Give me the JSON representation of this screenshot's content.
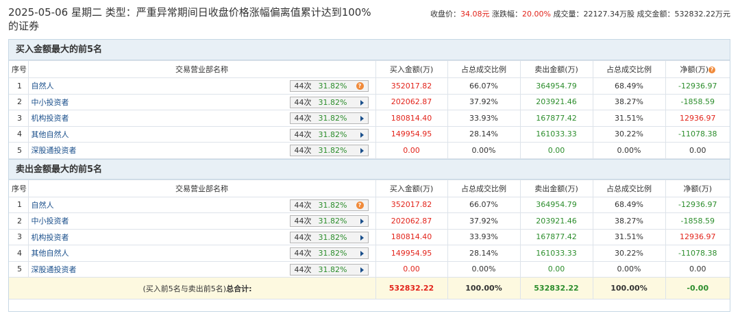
{
  "header": {
    "title": "2025-05-06 星期二 类型：严重异常期间日收盘价格涨幅偏离值累计达到100%的证券",
    "close_label": "收盘价：",
    "close_value": "34.08元",
    "change_label": "涨跌幅：",
    "change_value": "20.00%",
    "volume_label": "成交量：",
    "volume_value": "22127.34万股",
    "amount_label": "成交金额：",
    "amount_value": "532832.22万元"
  },
  "columns": [
    "序号",
    "交易营业部名称",
    "买入金额(万)",
    "占总成交比例",
    "卖出金额(万)",
    "占总成交比例",
    "净额(万)"
  ],
  "buy_section": {
    "title": "买入金额最大的前5名",
    "rows": [
      {
        "idx": "1",
        "name": "自然人",
        "times": "44次",
        "rate": "31.82%",
        "buy": "352017.82",
        "buy_pct": "66.07%",
        "sell": "364954.79",
        "sell_pct": "68.49%",
        "net": "-12936.97",
        "net_color": "green",
        "icon": "q"
      },
      {
        "idx": "2",
        "name": "中小投资者",
        "times": "44次",
        "rate": "31.82%",
        "buy": "202062.87",
        "buy_pct": "37.92%",
        "sell": "203921.46",
        "sell_pct": "38.27%",
        "net": "-1858.59",
        "net_color": "green",
        "icon": "arrow"
      },
      {
        "idx": "3",
        "name": "机构投资者",
        "times": "44次",
        "rate": "31.82%",
        "buy": "180814.40",
        "buy_pct": "33.93%",
        "sell": "167877.42",
        "sell_pct": "31.51%",
        "net": "12936.97",
        "net_color": "red",
        "icon": "arrow"
      },
      {
        "idx": "4",
        "name": "其他自然人",
        "times": "44次",
        "rate": "31.82%",
        "buy": "149954.95",
        "buy_pct": "28.14%",
        "sell": "161033.33",
        "sell_pct": "30.22%",
        "net": "-11078.38",
        "net_color": "green",
        "icon": "arrow"
      },
      {
        "idx": "5",
        "name": "深股通投资者",
        "times": "44次",
        "rate": "31.82%",
        "buy": "0.00",
        "buy_pct": "0.00%",
        "sell": "0.00",
        "sell_pct": "0.00%",
        "net": "0.00",
        "net_color": "plain",
        "icon": "arrow"
      }
    ]
  },
  "sell_section": {
    "title": "卖出金额最大的前5名",
    "rows": [
      {
        "idx": "1",
        "name": "自然人",
        "times": "44次",
        "rate": "31.82%",
        "buy": "352017.82",
        "buy_pct": "66.07%",
        "sell": "364954.79",
        "sell_pct": "68.49%",
        "net": "-12936.97",
        "net_color": "green",
        "icon": "q"
      },
      {
        "idx": "2",
        "name": "中小投资者",
        "times": "44次",
        "rate": "31.82%",
        "buy": "202062.87",
        "buy_pct": "37.92%",
        "sell": "203921.46",
        "sell_pct": "38.27%",
        "net": "-1858.59",
        "net_color": "green",
        "icon": "arrow"
      },
      {
        "idx": "3",
        "name": "机构投资者",
        "times": "44次",
        "rate": "31.82%",
        "buy": "180814.40",
        "buy_pct": "33.93%",
        "sell": "167877.42",
        "sell_pct": "31.51%",
        "net": "12936.97",
        "net_color": "red",
        "icon": "arrow"
      },
      {
        "idx": "4",
        "name": "其他自然人",
        "times": "44次",
        "rate": "31.82%",
        "buy": "149954.95",
        "buy_pct": "28.14%",
        "sell": "161033.33",
        "sell_pct": "30.22%",
        "net": "-11078.38",
        "net_color": "green",
        "icon": "arrow"
      },
      {
        "idx": "5",
        "name": "深股通投资者",
        "times": "44次",
        "rate": "31.82%",
        "buy": "0.00",
        "buy_pct": "0.00%",
        "sell": "0.00",
        "sell_pct": "0.00%",
        "net": "0.00",
        "net_color": "plain",
        "icon": "arrow"
      }
    ]
  },
  "total": {
    "label_prefix": "(买入前5名与卖出前5名)",
    "label_bold": "总合计:",
    "buy": "532832.22",
    "buy_pct": "100.00%",
    "sell": "532832.22",
    "sell_pct": "100.00%",
    "net": "-0.00"
  },
  "colors": {
    "red": "#e2231a",
    "green": "#2c8d2c",
    "link": "#1a4f8b",
    "section_bg": "#e8f0f6",
    "total_bg": "#fdf9e0",
    "border": "#c6d7e4"
  }
}
